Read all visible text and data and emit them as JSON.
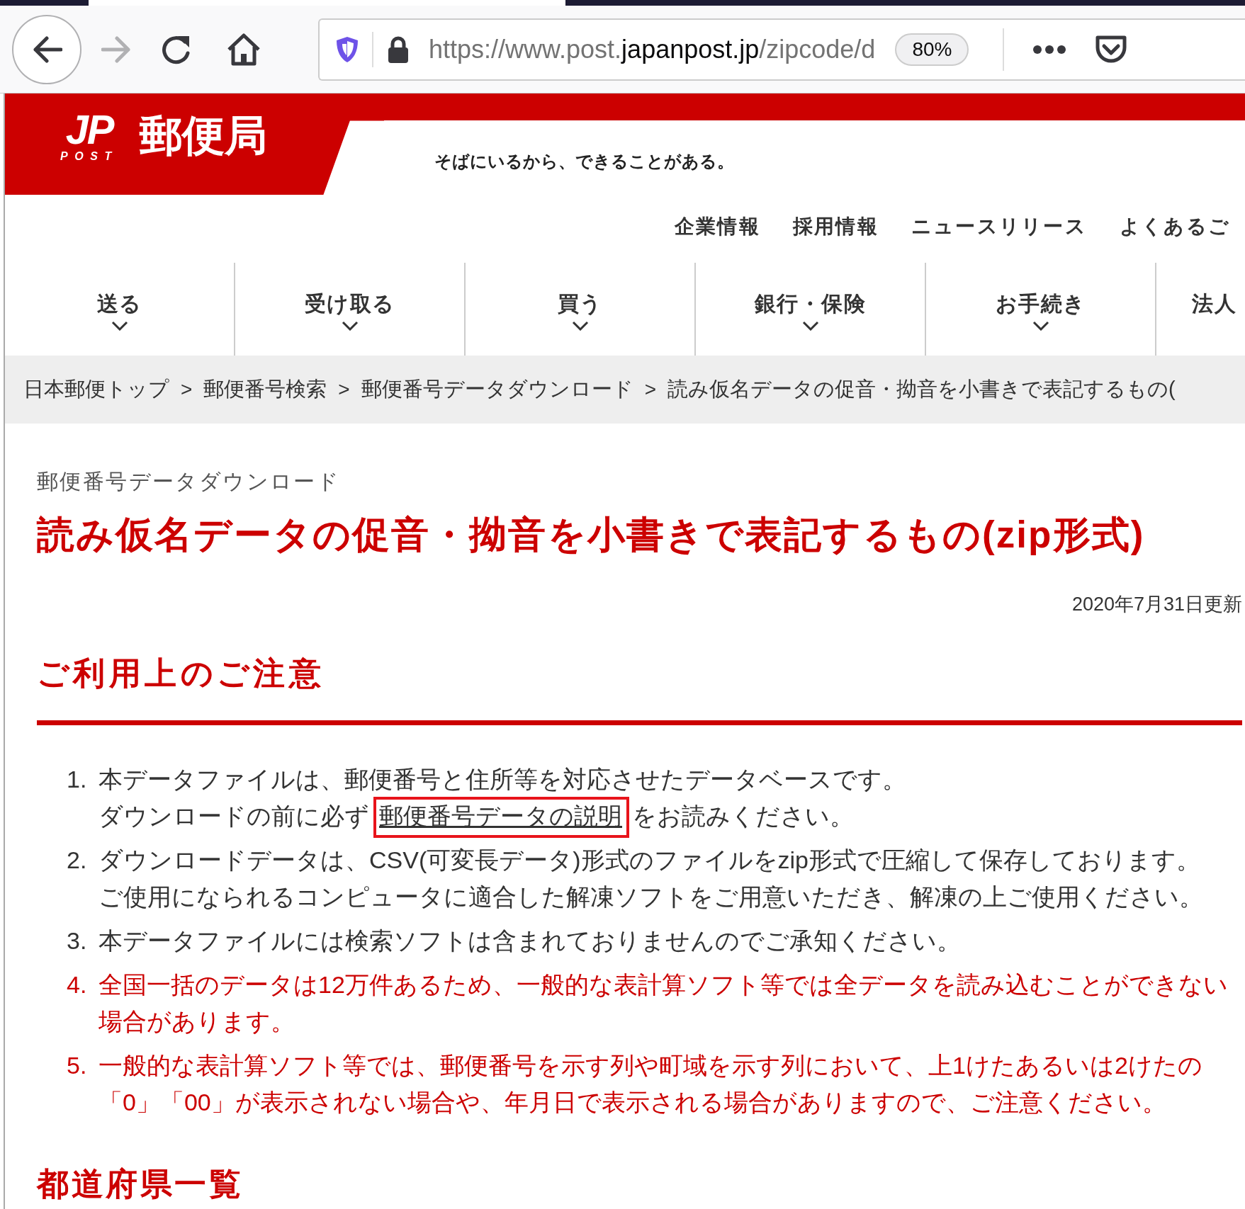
{
  "browser": {
    "url_host_prefix": "https://www.post.",
    "url_host": "japanpost.jp",
    "url_path": "/zipcode/d",
    "zoom": "80%",
    "back_enabled": true,
    "forward_enabled": false
  },
  "header": {
    "logo_mark": "JP",
    "logo_sub": "POST",
    "logo_name": "郵便局",
    "tagline": "そばにいるから、できることがある。"
  },
  "utility_links": [
    "企業情報",
    "採用情報",
    "ニュースリリース",
    "よくあるご"
  ],
  "nav": [
    {
      "label": "送る",
      "has_menu": true
    },
    {
      "label": "受け取る",
      "has_menu": true
    },
    {
      "label": "買う",
      "has_menu": true
    },
    {
      "label": "銀行・保険",
      "has_menu": true
    },
    {
      "label": "お手続き",
      "has_menu": true
    },
    {
      "label": "法人",
      "has_menu": false
    }
  ],
  "breadcrumb": [
    "日本郵便トップ",
    "郵便番号検索",
    "郵便番号データダウンロード",
    "読み仮名データの促音・拗音を小書きで表記するもの("
  ],
  "breadcrumb_separator": ">",
  "page": {
    "category": "郵便番号データダウンロード",
    "title": "読み仮名データの促音・拗音を小書きで表記するもの(zip形式)",
    "updated": "2020年7月31日更新"
  },
  "notice": {
    "heading": "ご利用上のご注意",
    "items": [
      {
        "number": "1.",
        "important": false,
        "lines": [
          "本データファイルは、郵便番号と住所等を対応させたデータベースです。"
        ],
        "link_line": {
          "before": "ダウンロードの前に必ず",
          "link": "郵便番号データの説明",
          "after": "をお読みください。",
          "highlighted": true
        }
      },
      {
        "number": "2.",
        "important": false,
        "lines": [
          "ダウンロードデータは、CSV(可変長データ)形式のファイルをzip形式で圧縮して保存しております。",
          "ご使用になられるコンピュータに適合した解凍ソフトをご用意いただき、解凍の上ご使用ください。"
        ]
      },
      {
        "number": "3.",
        "important": false,
        "lines": [
          "本データファイルには検索ソフトは含まれておりませんのでご承知ください。"
        ]
      },
      {
        "number": "4.",
        "important": true,
        "lines": [
          "全国一括のデータは12万件あるため、一般的な表計算ソフト等では全データを読み込むことができない",
          "場合があります。"
        ]
      },
      {
        "number": "5.",
        "important": true,
        "lines": [
          "一般的な表計算ソフト等では、郵便番号を示す列や町域を示す列において、上1けたあるいは2けたの",
          "「0」「00」が表示されない場合や、年月日で表示される場合がありますので、ご注意ください。"
        ]
      }
    ]
  },
  "next_heading": "都道府県一覧"
}
